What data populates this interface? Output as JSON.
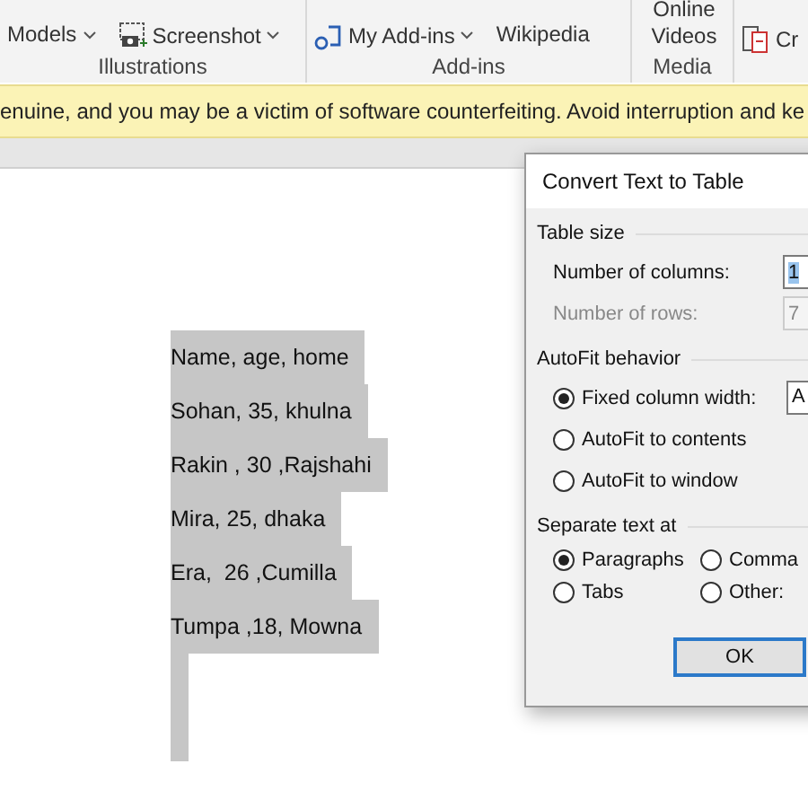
{
  "ribbon": {
    "groups": [
      {
        "label": "Illustrations",
        "commands": [
          {
            "text": "Models",
            "dropdown": true
          },
          {
            "text": "Screenshot",
            "dropdown": true
          }
        ]
      },
      {
        "label": "Add-ins",
        "commands": [
          {
            "text": "My Add-ins",
            "dropdown": true
          },
          {
            "text": "Wikipedia",
            "dropdown": false
          }
        ]
      },
      {
        "label": "Media",
        "commands": [
          {
            "text": "Online\nVideos",
            "dropdown": false
          }
        ]
      },
      {
        "commands": [
          {
            "text": "Cr",
            "dropdown": false
          }
        ]
      }
    ]
  },
  "warning_bar": {
    "text": "enuine, and you may be a victim of software counterfeiting. Avoid interruption and ke"
  },
  "document": {
    "lines": [
      "Name, age, home",
      "Sohan, 35, khulna",
      "Rakin , 30 ,Rajshahi",
      "Mira, 25, dhaka",
      "Era,  26 ,Cumilla",
      "Tumpa ,18, Mowna"
    ],
    "selected": true
  },
  "dialog": {
    "title": "Convert Text to Table",
    "sections": [
      {
        "title": "Table size",
        "rows": [
          {
            "kind": "spin",
            "label": "Number of columns:",
            "value": "1",
            "disabled": false,
            "highlighted": true
          },
          {
            "kind": "spin",
            "label": "Number of rows:",
            "value": "7",
            "disabled": true,
            "highlighted": false
          }
        ]
      },
      {
        "title": "AutoFit behavior",
        "rows": [
          {
            "kind": "radio",
            "label": "Fixed column width:",
            "selected": true,
            "value": "A"
          },
          {
            "kind": "radio",
            "label": "AutoFit to contents",
            "selected": false
          },
          {
            "kind": "radio",
            "label": "AutoFit to window",
            "selected": false
          }
        ]
      },
      {
        "title": "Separate text at",
        "grid": [
          {
            "label": "Paragraphs",
            "selected": true
          },
          {
            "label": "Comma",
            "selected": false
          },
          {
            "label": "Tabs",
            "selected": false
          },
          {
            "label": "Other:",
            "selected": false
          }
        ]
      }
    ],
    "button": "OK"
  }
}
